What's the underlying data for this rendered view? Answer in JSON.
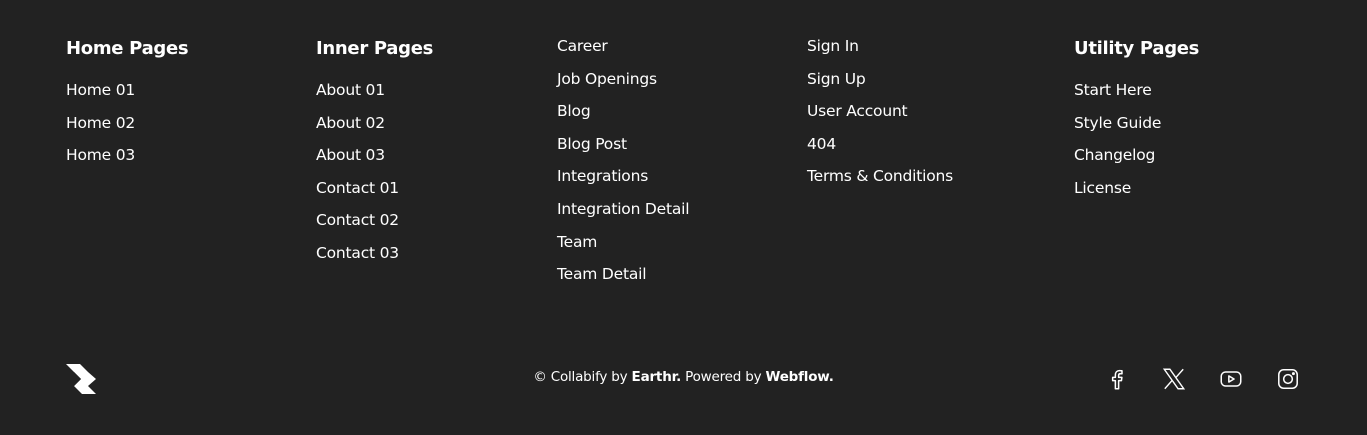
{
  "columns": [
    {
      "title": "Home Pages",
      "links": [
        "Home 01",
        "Home 02",
        "Home 03"
      ]
    },
    {
      "title": "Inner Pages",
      "links": [
        "About 01",
        "About 02",
        "About 03",
        "Contact 01",
        "Contact 02",
        "Contact 03"
      ]
    },
    {
      "title": "",
      "links": [
        "Career",
        "Job Openings",
        "Blog",
        "Blog Post",
        "Integrations",
        "Integration Detail",
        "Team",
        "Team Detail"
      ]
    },
    {
      "title": "",
      "links": [
        "Sign In",
        "Sign Up",
        "User Account",
        "404",
        "Terms & Conditions"
      ]
    },
    {
      "title": "Utility Pages",
      "links": [
        "Start Here",
        "Style Guide",
        "Changelog",
        "License"
      ]
    }
  ],
  "footer": {
    "logo_icon": "collabify-logo-icon",
    "copyright_prefix": "© Collabify by ",
    "author": "Earthr.",
    "powered_text": " Powered by ",
    "platform": "Webflow.",
    "socials": [
      {
        "name": "facebook-icon"
      },
      {
        "name": "x-twitter-icon"
      },
      {
        "name": "youtube-icon"
      },
      {
        "name": "instagram-icon"
      }
    ]
  },
  "colors": {
    "background": "#222222",
    "text": "#ffffff"
  }
}
